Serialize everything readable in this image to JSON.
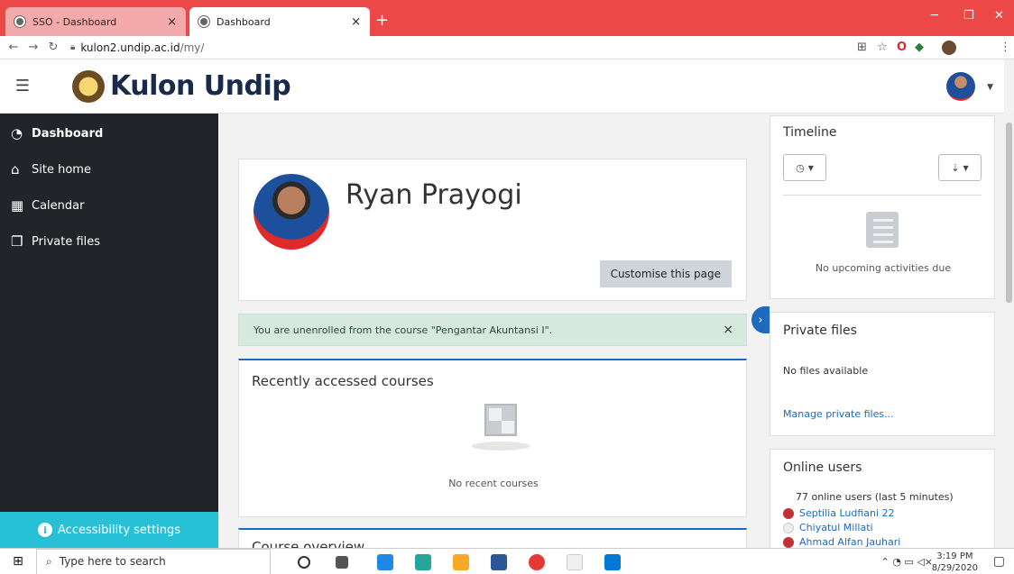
{
  "browser": {
    "tabs": [
      {
        "title": "SSO - Dashboard",
        "close": "×"
      },
      {
        "title": "Dashboard",
        "close": "×"
      }
    ],
    "new_tab": "+",
    "url_host": "kulon2.undip.ac.id",
    "url_path": "/my/"
  },
  "header": {
    "site_name": "Kulon Undip"
  },
  "sidebar": {
    "items": [
      {
        "label": "Dashboard",
        "icon": "dashboard-icon"
      },
      {
        "label": "Site home",
        "icon": "home-icon"
      },
      {
        "label": "Calendar",
        "icon": "calendar-icon"
      },
      {
        "label": "Private files",
        "icon": "files-icon"
      }
    ],
    "accessibility": "Accessibility settings"
  },
  "profile": {
    "name": "Ryan Prayogi",
    "customise_label": "Customise this page"
  },
  "alert": {
    "message": "You are unenrolled from the course \"Pengantar Akuntansi I\".",
    "close": "×"
  },
  "recent_courses": {
    "title": "Recently accessed courses",
    "empty": "No recent courses"
  },
  "course_overview": {
    "title": "Course overview"
  },
  "timeline": {
    "title": "Timeline",
    "empty": "No upcoming activities due"
  },
  "private_files": {
    "title": "Private files",
    "empty": "No files available",
    "manage_link": "Manage private files..."
  },
  "online_users": {
    "title": "Online users",
    "count_text": "77 online users (last 5 minutes)",
    "users": [
      "Septilia Ludfiani 22",
      "Chiyatul Millati",
      "Ahmad Alfan Jauhari"
    ]
  },
  "taskbar": {
    "search_placeholder": "Type here to search",
    "time": "3:19 PM",
    "date": "8/29/2020"
  },
  "colors": {
    "tab_bar": "#ed4848",
    "sidebar": "#212529",
    "accent": "#1d6ac0",
    "accessibility": "#28c0d7",
    "alert_bg": "#d7e9de"
  }
}
